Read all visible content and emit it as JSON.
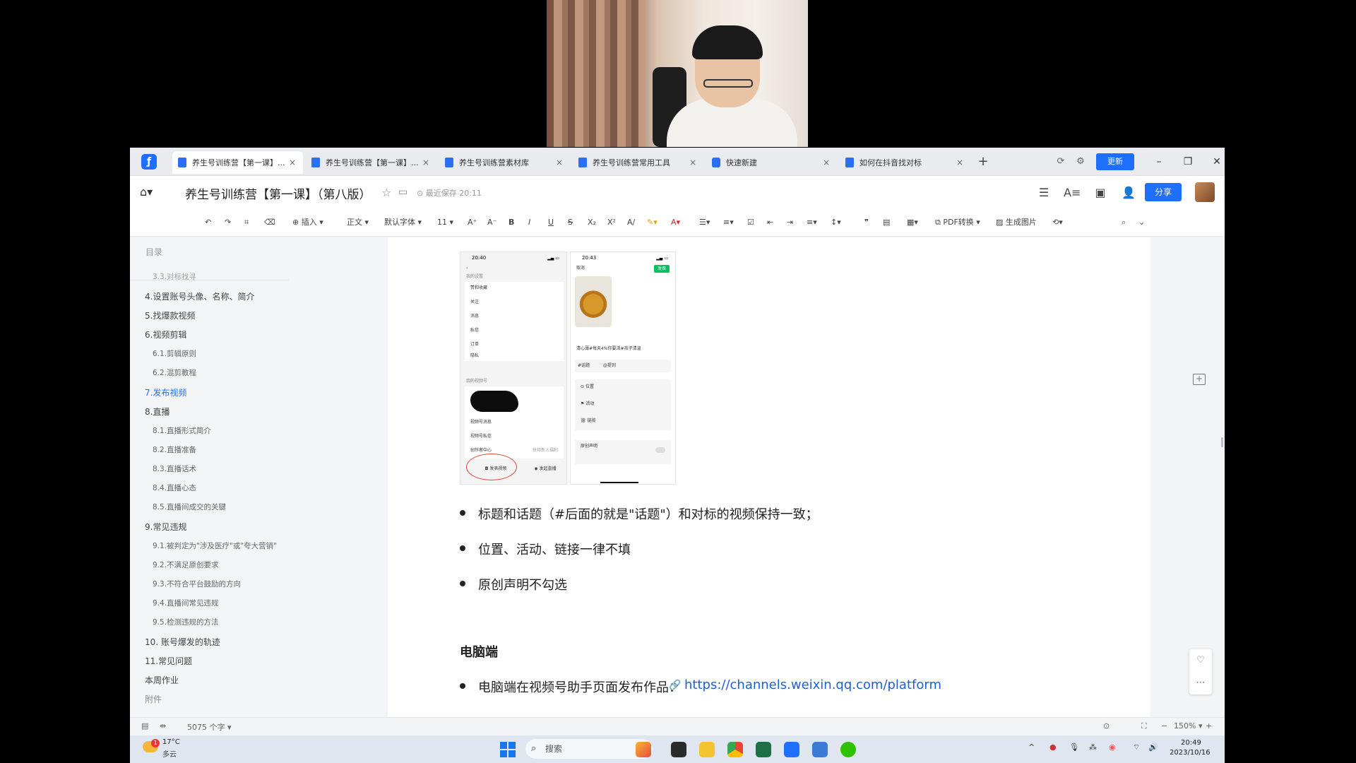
{
  "tabs": [
    {
      "label": "养生号训练营【第一课】...",
      "active": true
    },
    {
      "label": "养生号训练营【第一课】...",
      "active": false
    },
    {
      "label": "养生号训练营素材库",
      "active": false
    },
    {
      "label": "养生号训练营常用工具",
      "active": false
    },
    {
      "label": "快速新建",
      "active": false
    },
    {
      "label": "如何在抖音找对标",
      "active": false
    }
  ],
  "tab_close": "×",
  "tab_add": "+",
  "update_label": "更新",
  "title": "养生号训练营【第一课】（第八版）",
  "save_status": "最近保存 20:11",
  "share_label": "分享",
  "toolbar": {
    "insert": "插入",
    "style": "正文",
    "font": "默认字体",
    "size": "11",
    "pdf": "PDF转换",
    "gen_image": "生成图片"
  },
  "toc": {
    "heading": "目录",
    "items": [
      {
        "label": "3.3.对标找寻",
        "level": 2
      },
      {
        "label": "4.设置账号头像、名称、简介",
        "level": 1
      },
      {
        "label": "5.找爆款视频",
        "level": 1
      },
      {
        "label": "6.视频剪辑",
        "level": 1
      },
      {
        "label": "6.1.剪辑原则",
        "level": 2
      },
      {
        "label": "6.2.混剪教程",
        "level": 2
      },
      {
        "label": "7.发布视频",
        "level": 1,
        "active": true
      },
      {
        "label": "8.直播",
        "level": 1
      },
      {
        "label": "8.1.直播形式简介",
        "level": 2
      },
      {
        "label": "8.2.直播准备",
        "level": 2
      },
      {
        "label": "8.3.直播话术",
        "level": 2
      },
      {
        "label": "8.4.直播心态",
        "level": 2
      },
      {
        "label": "8.5.直播间成交的关键",
        "level": 2
      },
      {
        "label": "9.常见违规",
        "level": 1
      },
      {
        "label": "9.1.被判定为\"涉及医疗\"或\"夸大营销\"",
        "level": 2
      },
      {
        "label": "9.2.不满足原创要求",
        "level": 2
      },
      {
        "label": "9.3.不符合平台鼓励的方向",
        "level": 2
      },
      {
        "label": "9.4.直播间常见违规",
        "level": 2
      },
      {
        "label": "9.5.检测违规的方法",
        "level": 2
      },
      {
        "label": "10. 账号爆发的轨迹",
        "level": 1
      },
      {
        "label": "11.常见问题",
        "level": 1
      },
      {
        "label": "本周作业",
        "level": 1
      },
      {
        "label": "附件",
        "level": 1
      }
    ]
  },
  "phone_left": {
    "time": "20:40",
    "section": "我的设置",
    "rows": [
      "赞和收藏",
      "关注",
      "消息",
      "私信",
      "订单",
      "隐私"
    ],
    "section2": "我的视频号",
    "rows2": [
      "视频号消息",
      "视频号私信",
      "创作者中心"
    ],
    "creator_right": "扶持新人福利",
    "publish_video": "发表视频",
    "start_live": "发起直播"
  },
  "phone_right": {
    "time": "20:43",
    "cancel": "取消",
    "publish": "发表",
    "caption": "清心薄#每天4%你要活#孩子清温",
    "tags": [
      "#话题",
      "@提到"
    ],
    "rows": [
      "位置",
      "活动",
      "链接"
    ],
    "original": "原创声明"
  },
  "bullets": [
    "标题和话题（#后面的就是\"话题\"）和对标的视频保持一致；",
    "位置、活动、链接一律不填",
    "原创声明不勾选"
  ],
  "section_heading": "电脑端",
  "pc_bullet": "电脑端在视频号助手页面发布作品：",
  "pc_link": "https://channels.weixin.qq.com/platform",
  "statusbar": {
    "word_count": "5075 个字",
    "zoom": "150%"
  },
  "taskbar": {
    "badge": "1",
    "temp": "17°C",
    "weather": "多云",
    "search": "搜索",
    "time": "20:49",
    "date": "2023/10/16"
  }
}
